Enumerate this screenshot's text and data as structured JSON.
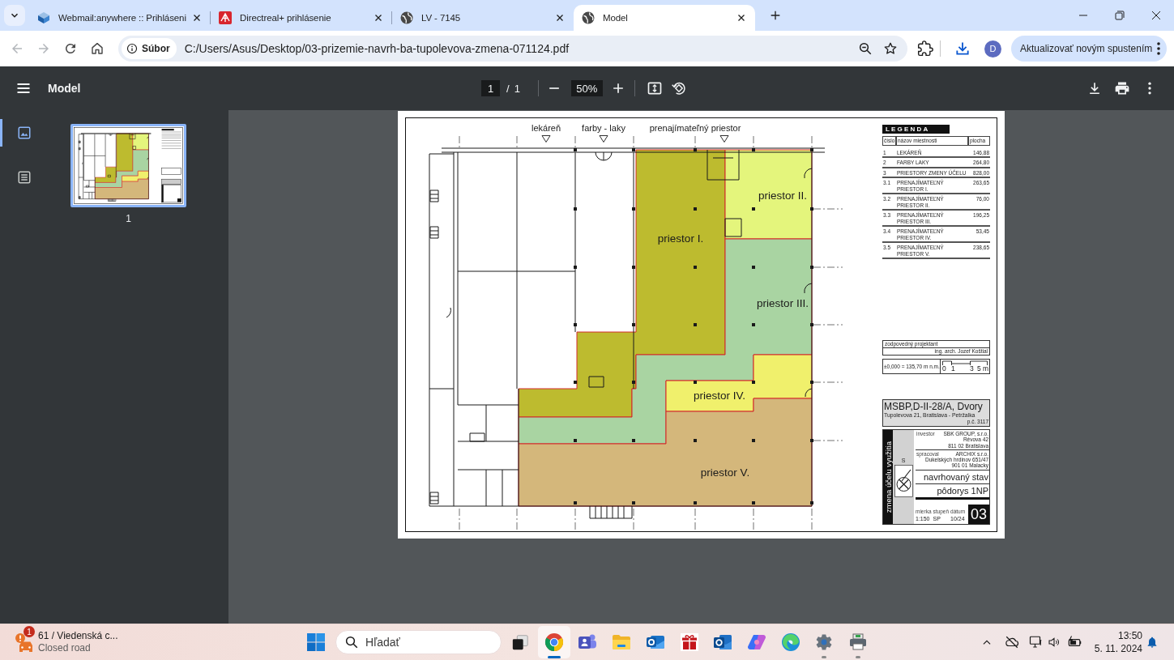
{
  "tab_strip": {
    "tabs": [
      {
        "kind": "cube",
        "title": "Webmail:anywhere :: Prihláseni",
        "selected": false
      },
      {
        "kind": "logo",
        "title": "Directreal+ prihlásenie",
        "selected": false
      },
      {
        "kind": "globe",
        "title": "LV - 7145",
        "selected": false
      },
      {
        "kind": "globe",
        "title": "Model",
        "selected": true
      }
    ]
  },
  "toolbar": {
    "nav_buttons": [
      {
        "kind": "back",
        "disabled": true
      },
      {
        "kind": "forward",
        "disabled": true
      },
      {
        "kind": "reload",
        "disabled": false
      },
      {
        "kind": "home",
        "disabled": false
      }
    ],
    "site_chip": "Súbor",
    "url": "C:/Users/Asus/Desktop/03-prizemie-navrh-ba-tupolevova-zmena-071124.pdf",
    "profile_initial": "D",
    "update_button": "Aktualizovať novým spustením"
  },
  "pdf_toolbar": {
    "title": "Model",
    "page": "1",
    "page_separator": "/",
    "page_count": "1",
    "zoom": "50%"
  },
  "sidebar": {
    "views": [
      {
        "kind": "thumbnails",
        "selected": true
      },
      {
        "kind": "outline",
        "selected": false
      }
    ],
    "thumbnails": [
      {
        "label": "1",
        "selected": true
      }
    ]
  },
  "plan": {
    "markers": [
      "lekáreň",
      "farby - laky",
      "prenajímateľný priestor"
    ],
    "rooms": [
      {
        "label": "priestor I.",
        "color": "#bdbb2f"
      },
      {
        "label": "priestor II.",
        "color": "#e4f57c"
      },
      {
        "label": "priestor III.",
        "color": "#a9d4a2"
      },
      {
        "label": "priestor IV.",
        "color": "#f0f06c"
      },
      {
        "label": "priestor V.",
        "color": "#d4b77b"
      }
    ],
    "legend": {
      "title": "LEGENDA",
      "columns": [
        "číslo",
        "názov miestnosti",
        "plocha"
      ],
      "rows": [
        {
          "number": "1",
          "name": "LEKÁREŇ",
          "area": "146,88"
        },
        {
          "number": "2",
          "name": "FARBY LAKY",
          "area": "264,80"
        },
        {
          "number": "3",
          "name": "PRIESTORY ZMENY ÚČELU",
          "area": "828,00"
        },
        {
          "number": "3.1",
          "name": "PRENAJÍMATEĽNÝ PRIESTOR I.",
          "area": "263,65"
        },
        {
          "number": "3.2",
          "name": "PRENAJÍMATEĽNÝ PRIESTOR II.",
          "area": "76,00"
        },
        {
          "number": "3.3",
          "name": "PRENAJÍMATEĽNÝ PRIESTOR III.",
          "area": "196,25"
        },
        {
          "number": "3.4",
          "name": "PRENAJÍMATEĽNÝ PRIESTOR IV.",
          "area": "53,45"
        },
        {
          "number": "3.5",
          "name": "PRENAJÍMATEĽNÝ PRIESTOR V.",
          "area": "238,65"
        }
      ]
    },
    "title_block": {
      "designer_label": "zodpovedný projektant",
      "designer": "ing. arch. Jozef Koštial",
      "height_reference": "±0,000 = 135,70 m n.m.",
      "scale_labels": [
        "0",
        "1",
        "3",
        "5 m"
      ],
      "project": "MSBP,D-II-28/A, Dvory",
      "address": "Tupolevova 21, Bratislava - Petržalka",
      "parcel": "p.č. 3117",
      "purpose": "zmena účelu využitia",
      "logo_letter": "S",
      "investor_label": "investor",
      "investor_lines": [
        "SBK GROUP, s.r.o.",
        "Révova 42",
        "811 02 Bratislava"
      ],
      "firm_label": "spracoval",
      "firm_lines": [
        "ARCHIX s.r.o.",
        "Dukelských hrdinov 651/47",
        "901 01 Malacky"
      ],
      "stage": "navrhovaný stav",
      "drawing_title": "pôdorys 1NP",
      "meta": [
        {
          "label": "mierka",
          "value": "1:150"
        },
        {
          "label": "stupeň",
          "value": "SP"
        },
        {
          "label": "dátum",
          "value": "10/24"
        }
      ],
      "sheet_number": "03"
    }
  },
  "taskbar": {
    "widget": {
      "title": "61 / Viedenská c...",
      "subtitle": "Closed road",
      "badge": "1"
    },
    "search": {
      "placeholder": "Hľadať"
    },
    "apps": [
      {
        "kind": "taskview",
        "selected": false,
        "running": false
      },
      {
        "kind": "browser",
        "selected": true,
        "running": true
      },
      {
        "kind": "chat",
        "selected": false,
        "running": false
      },
      {
        "kind": "folder",
        "selected": false,
        "running": false
      },
      {
        "kind": "mail",
        "selected": false,
        "running": false
      },
      {
        "kind": "gift",
        "selected": false,
        "running": false
      },
      {
        "kind": "mailbox",
        "selected": false,
        "running": false
      },
      {
        "kind": "assistant",
        "selected": false,
        "running": false
      },
      {
        "kind": "wave",
        "selected": false,
        "running": false
      },
      {
        "kind": "settings",
        "selected": false,
        "running": true
      },
      {
        "kind": "scanner",
        "selected": false,
        "running": true
      }
    ],
    "clock": {
      "time": "13:50",
      "date": "5. 11. 2024"
    }
  }
}
